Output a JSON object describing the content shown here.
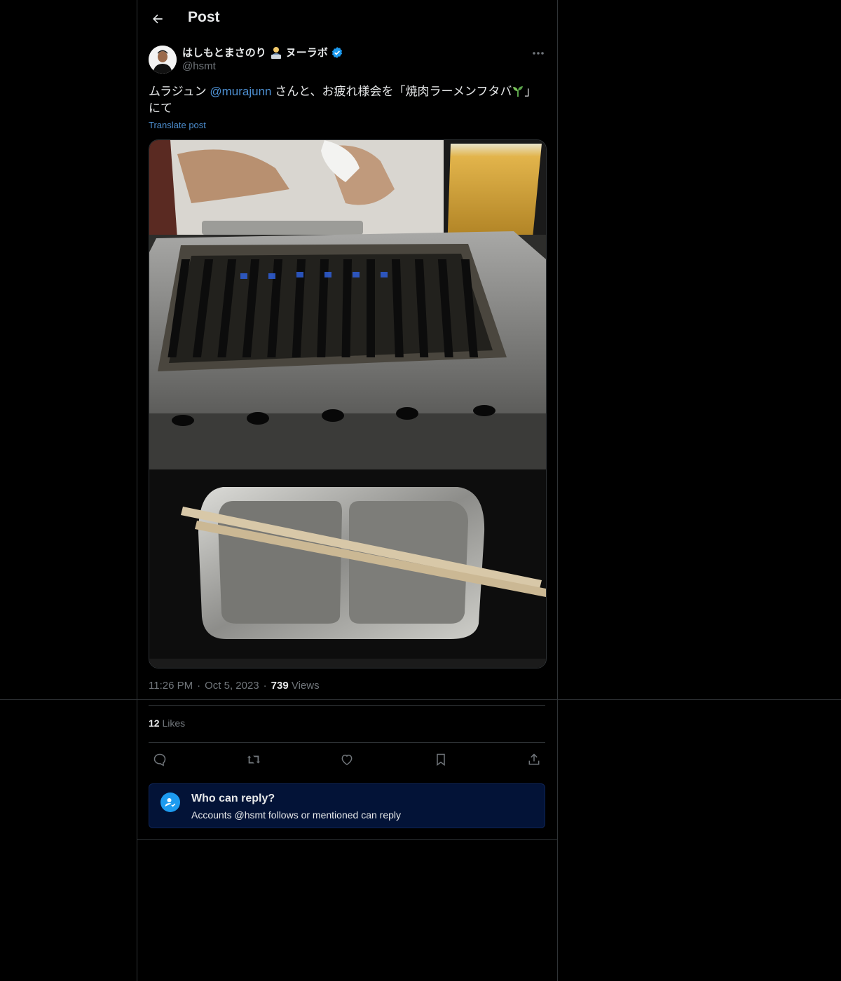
{
  "header": {
    "title": "Post"
  },
  "post": {
    "author_name": "はしもとまさのり",
    "author_org": "ヌーラボ",
    "handle": "@hsmt",
    "text_before": "ムラジュン ",
    "mention": "@murajunn",
    "text_after": " さんと、お疲れ様会を「焼肉ラーメンフタバ",
    "text_close": "」にて",
    "translate_label": "Translate post",
    "time": "11:26 PM",
    "date": "Oct 5, 2023",
    "views_count": "739",
    "views_label": "Views",
    "likes_count": "12",
    "likes_label": "Likes"
  },
  "reply_settings": {
    "title": "Who can reply?",
    "subtitle": "Accounts @hsmt follows or mentioned can reply"
  },
  "colors": {
    "accent": "#1d9bf0",
    "link": "#4d8fd1",
    "box_bg": "#031337",
    "border": "#2f3336"
  },
  "icons": [
    "back-arrow-icon",
    "verified-badge-icon",
    "more-icon",
    "reply-icon",
    "repost-icon",
    "like-icon",
    "bookmark-icon",
    "share-icon",
    "person-check-icon"
  ]
}
